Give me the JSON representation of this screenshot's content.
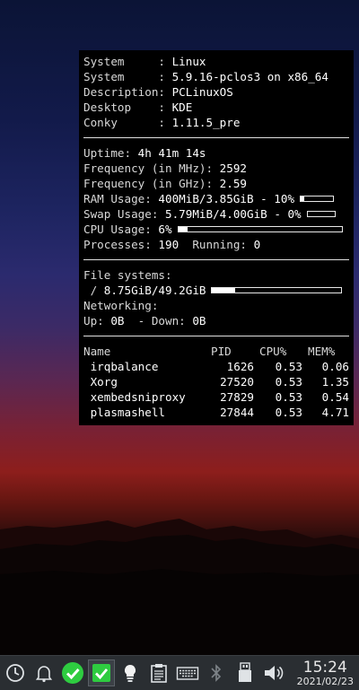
{
  "conky": {
    "system_info": [
      {
        "label": "System     : ",
        "value": "Linux"
      },
      {
        "label": "System     : ",
        "value": "5.9.16-pclos3 on x86_64"
      },
      {
        "label": "Description: ",
        "value": "PCLinuxOS"
      },
      {
        "label": "Desktop    : ",
        "value": "KDE"
      },
      {
        "label": "Conky      : ",
        "value": "1.11.5_pre"
      }
    ],
    "uptime": {
      "label": "Uptime: ",
      "value": "4h 41m 14s"
    },
    "freq_mhz": {
      "label": "Frequency (in MHz): ",
      "value": "2592"
    },
    "freq_ghz": {
      "label": "Frequency (in GHz): ",
      "value": "2.59"
    },
    "ram": {
      "label": "RAM Usage: ",
      "value": "400MiB/3.85GiB - 10%",
      "fraction": 0.1
    },
    "swap": {
      "label": "Swap Usage: ",
      "value": "5.79MiB/4.00GiB - 0%",
      "fraction": 0.0
    },
    "cpu": {
      "label": "CPU Usage: ",
      "value": "6%",
      "fraction": 0.06
    },
    "processes": {
      "label": "Processes: ",
      "value": "190",
      "running_label": "  Running: ",
      "running_value": "0"
    },
    "filesystems": {
      "label": "File systems:",
      "mount": " / ",
      "value": "8.75GiB/49.2GiB",
      "fraction": 0.18
    },
    "networking": {
      "label": "Networking:",
      "up_label": "Up: ",
      "up_value": "0B",
      "down_label": "  - Down: ",
      "down_value": "0B"
    },
    "process_table": {
      "headers": {
        "name": "Name",
        "pid": "PID",
        "cpu": "CPU%",
        "mem": "MEM%"
      },
      "rows": [
        {
          "name": " irqbalance",
          "pid": "1626",
          "cpu": "0.53",
          "mem": "0.06"
        },
        {
          "name": " Xorg",
          "pid": "27520",
          "cpu": "0.53",
          "mem": "1.35"
        },
        {
          "name": " xembedsniproxy",
          "pid": "27829",
          "cpu": "0.53",
          "mem": "0.54"
        },
        {
          "name": " plasmashell",
          "pid": "27844",
          "cpu": "0.53",
          "mem": "4.71"
        }
      ]
    }
  },
  "taskbar": {
    "icons": [
      "clock-icon",
      "notifications-bell-icon",
      "update-check-icon",
      "task-checkbox-icon",
      "lightbulb-icon",
      "clipboard-icon",
      "keyboard-icon",
      "bluetooth-icon",
      "usb-drive-icon",
      "volume-icon"
    ],
    "time": "15:24",
    "date": "2021/02/23"
  },
  "colors": {
    "panel": "#000000",
    "taskbar": "#2a2e32",
    "accent_green": "#2ecc40"
  }
}
